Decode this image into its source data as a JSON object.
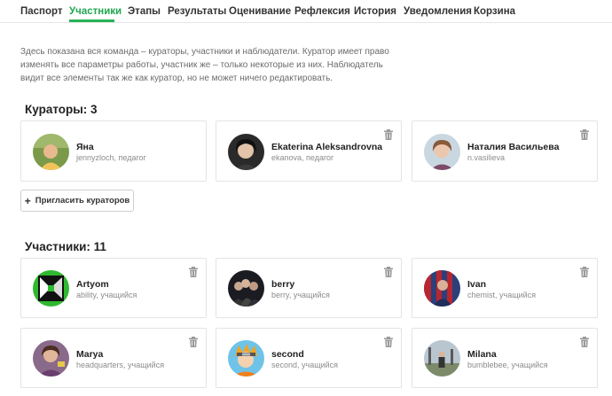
{
  "tabs": [
    {
      "label": "Паспорт",
      "active": false
    },
    {
      "label": "Участники",
      "active": true
    },
    {
      "label": "Этапы",
      "active": false
    },
    {
      "label": "Результаты",
      "active": false
    },
    {
      "label": "Оценивание",
      "active": false
    },
    {
      "label": "Рефлексия",
      "active": false
    },
    {
      "label": "История",
      "active": false
    },
    {
      "label": "Уведомления",
      "active": false
    },
    {
      "label": "Корзина",
      "active": false
    }
  ],
  "intro": "Здесь показана вся команда – кураторы, участники и наблюдатели. Куратор имеет право изменять все параметры работы, участник же – только некоторые из них. Наблюдатель видит все элементы так же как куратор, но не может ничего редактировать.",
  "curators": {
    "title": "Кураторы: 3",
    "invite_label": "Пригласить кураторов",
    "items": [
      {
        "name": "Яна",
        "sub": "jennyzloch, педагог",
        "icon": "avatar",
        "deletable": false
      },
      {
        "name": "Ekaterina Aleksandrovna",
        "sub": "ekanova, педагог",
        "icon": "avatar",
        "deletable": true
      },
      {
        "name": "Наталия Васильева",
        "sub": "n.vasilieva",
        "icon": "avatar",
        "deletable": true
      }
    ]
  },
  "participants": {
    "title": "Участники: 11",
    "items": [
      {
        "name": "Artyom",
        "sub": "ability, учащийся",
        "icon": "avatar",
        "deletable": true
      },
      {
        "name": "berry",
        "sub": "berry, учащийся",
        "icon": "avatar",
        "deletable": true
      },
      {
        "name": "Ivan",
        "sub": "chemist, учащийся",
        "icon": "avatar",
        "deletable": true
      },
      {
        "name": "Marya",
        "sub": "headquarters, учащийся",
        "icon": "avatar",
        "deletable": true
      },
      {
        "name": "second",
        "sub": "second, учащийся",
        "icon": "avatar",
        "deletable": true
      },
      {
        "name": "Milana",
        "sub": "bumblebee, учащийся",
        "icon": "avatar",
        "deletable": true
      }
    ]
  },
  "colors": {
    "accent": "#1fa750",
    "border": "#e4e4e4",
    "muted": "#8c8c8c",
    "trash": "#9a9a9a"
  }
}
